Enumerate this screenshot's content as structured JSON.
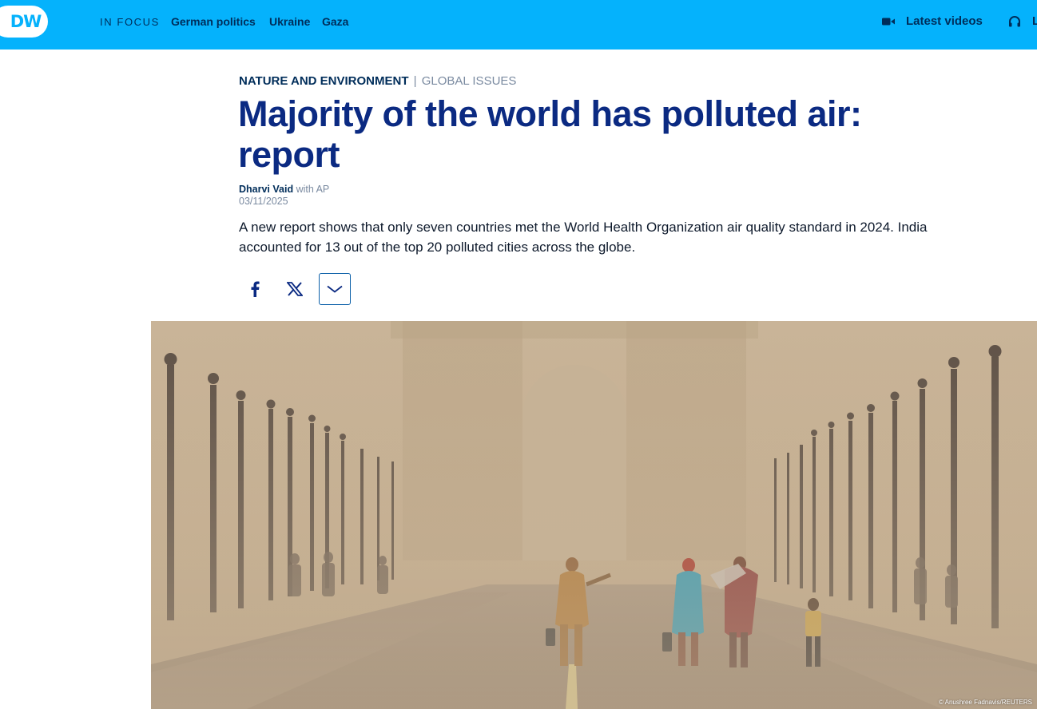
{
  "nav": {
    "logo_text": "DW",
    "in_focus_label": "IN FOCUS",
    "links": [
      "German politics",
      "Ukraine",
      "Gaza"
    ],
    "latest_videos_label": "Latest videos",
    "live_label": "L",
    "colors": {
      "bar": "#05b2fc",
      "text": "#002d5a"
    }
  },
  "article": {
    "category": "NATURE AND ENVIRONMENT",
    "separator": "|",
    "subcategory": "GLOBAL ISSUES",
    "headline": "Majority of the world has polluted air: report",
    "author": "Dharvi Vaid",
    "author_suffix": "with AP",
    "date": "03/11/2025",
    "teaser": "A new report shows that only seven countries met the World Health Organization air quality standard in 2024. India accounted for 13 out of the top 20 polluted cities across the globe.",
    "headline_color": "#0b2a82"
  },
  "share": {
    "icons": [
      "facebook-icon",
      "x-icon",
      "chevron-down-icon"
    ]
  },
  "image": {
    "credit": "© Anushree Fadnavis/REUTERS"
  }
}
